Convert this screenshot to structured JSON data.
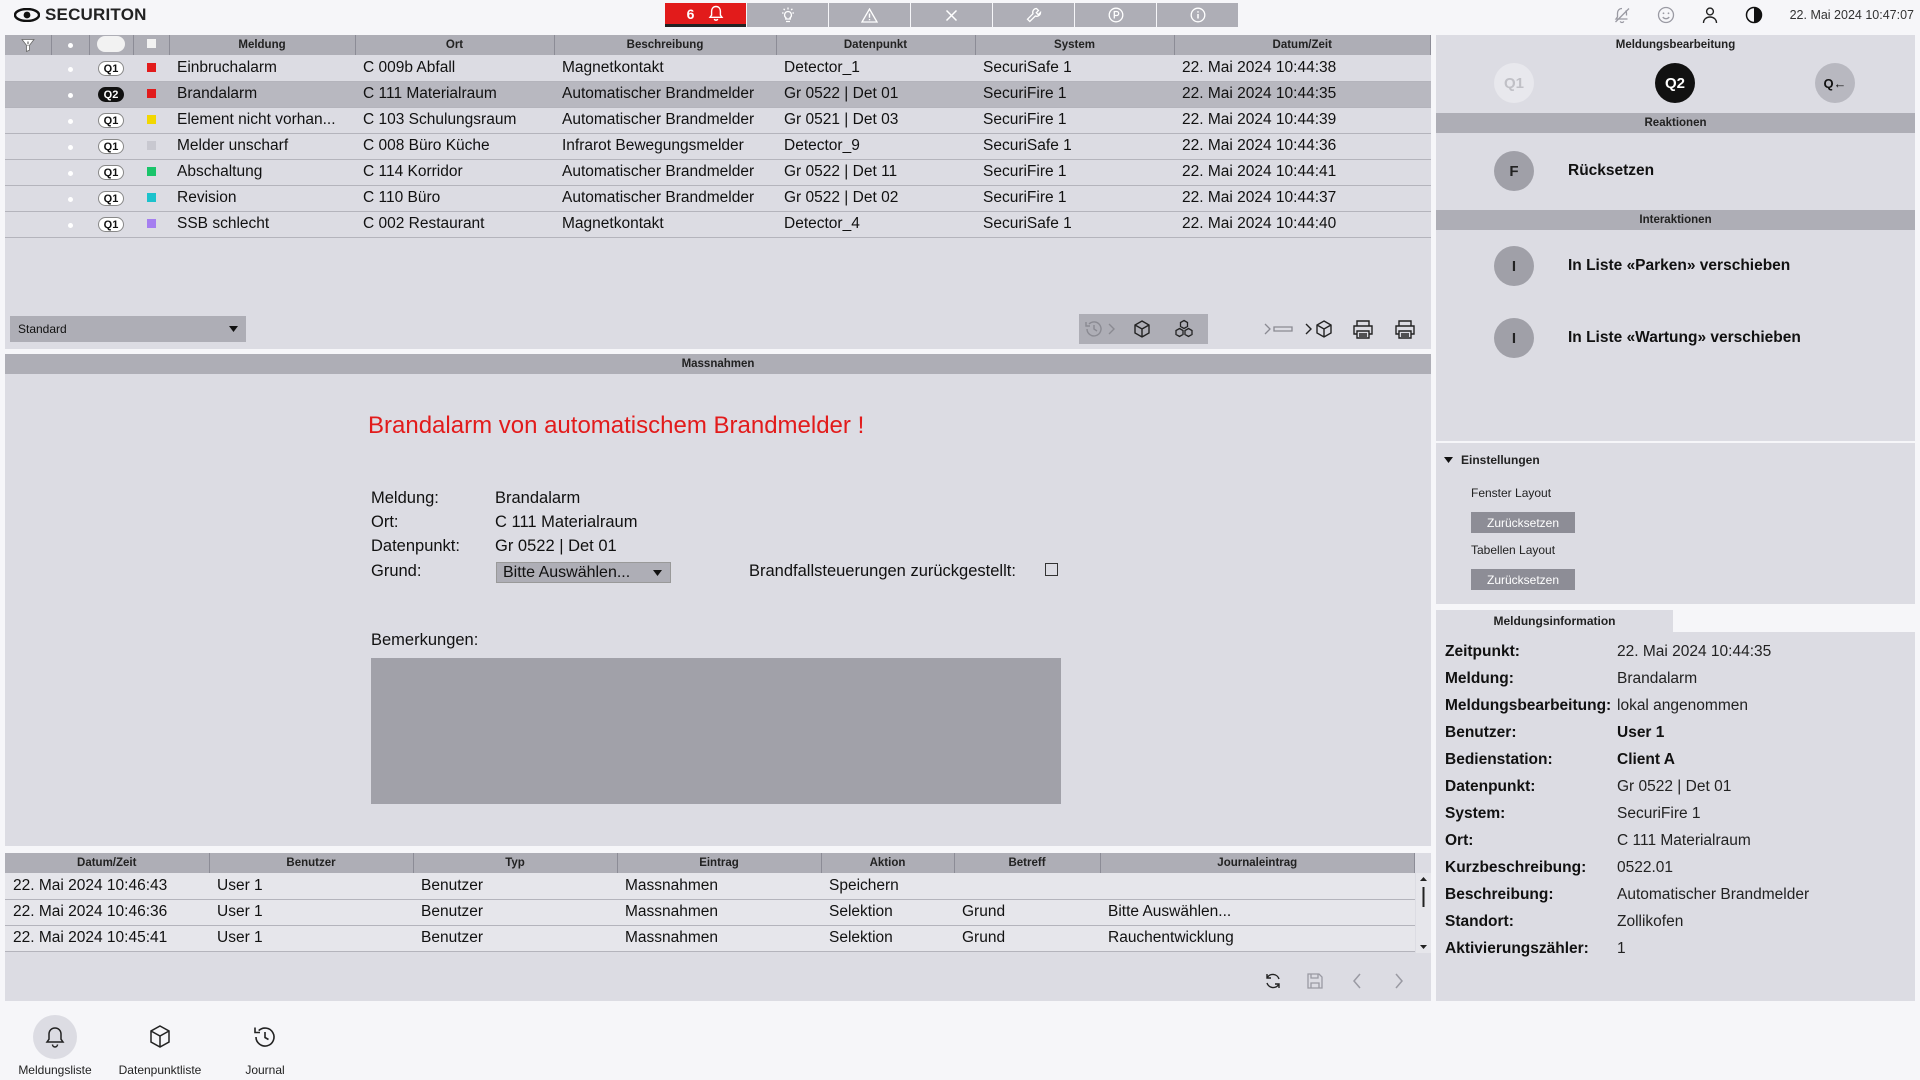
{
  "app": {
    "brand": "SECURITON",
    "datetime": "22. Mai 2024 10:47:07"
  },
  "toptabs": {
    "alarm_count": "6",
    "tabs": [
      "bell-icon",
      "lamp-icon",
      "warning-icon",
      "close-icon",
      "wrench-icon",
      "parking-icon",
      "info-icon"
    ]
  },
  "colors": {
    "alarm_red": "#e21b1b",
    "panel": "#dcdce3",
    "header": "#aeaeb6"
  },
  "msglist": {
    "columns": [
      "Meldung",
      "Ort",
      "Beschreibung",
      "Datenpunkt",
      "System",
      "Datum/Zeit"
    ],
    "rows": [
      {
        "q": "Q1",
        "color": "#e21b1b",
        "meldung": "Einbruchalarm",
        "ort": "C 009b Abfall",
        "beschreibung": "Magnetkontakt",
        "datenpunkt": "Detector_1",
        "system": "SecuriSafe 1",
        "datum": "22. Mai 2024 10:44:38"
      },
      {
        "q": "Q2",
        "color": "#e21b1b",
        "meldung": "Brandalarm",
        "ort": "C 111 Materialraum",
        "beschreibung": "Automatischer Brandmelder",
        "datenpunkt": "Gr 0522 | Det 01",
        "system": "SecuriFire 1",
        "datum": "22. Mai 2024 10:44:35"
      },
      {
        "q": "Q1",
        "color": "#f2d700",
        "meldung": "Element nicht vorhan...",
        "ort": "C 103 Schulungsraum",
        "beschreibung": "Automatischer Brandmelder",
        "datenpunkt": "Gr 0521 | Det 03",
        "system": "SecuriFire 1",
        "datum": "22. Mai 2024 10:44:39"
      },
      {
        "q": "Q1",
        "color": "#c8c8d0",
        "meldung": "Melder unscharf",
        "ort": "C 008 Büro Küche",
        "beschreibung": "Infrarot Bewegungsmelder",
        "datenpunkt": "Detector_9",
        "system": "SecuriSafe 1",
        "datum": "22. Mai 2024 10:44:36"
      },
      {
        "q": "Q1",
        "color": "#19c46a",
        "meldung": "Abschaltung",
        "ort": "C 114 Korridor",
        "beschreibung": "Automatischer Brandmelder",
        "datenpunkt": "Gr 0522 | Det 11",
        "system": "SecuriFire 1",
        "datum": "22. Mai 2024 10:44:41"
      },
      {
        "q": "Q1",
        "color": "#1cc2cc",
        "meldung": "Revision",
        "ort": "C 110 Büro",
        "beschreibung": "Automatischer Brandmelder",
        "datenpunkt": "Gr 0522 | Det 02",
        "system": "SecuriFire 1",
        "datum": "22. Mai 2024 10:44:37"
      },
      {
        "q": "Q1",
        "color": "#a57ef0",
        "meldung": "SSB schlecht",
        "ort": "C 002 Restaurant",
        "beschreibung": "Magnetkontakt",
        "datenpunkt": "Detector_4",
        "system": "SecuriSafe 1",
        "datum": "22. Mai 2024 10:44:40"
      }
    ],
    "filter_value": "Standard"
  },
  "massnahmen": {
    "header": "Massnahmen",
    "title": "Brandalarm von automatischem Brandmelder !",
    "meldung_label": "Meldung:",
    "meldung_value": "Brandalarm",
    "ort_label": "Ort:",
    "ort_value": "C 111 Materialraum",
    "datenpunkt_label": "Datenpunkt:",
    "datenpunkt_value": "Gr 0522 | Det 01",
    "grund_label": "Grund:",
    "grund_value": "Bitte Auswählen...",
    "brandfall_label": "Brandfallsteuerungen zurückgestellt:",
    "bemerkungen_label": "Bemerkungen:"
  },
  "journal": {
    "columns": [
      "Datum/Zeit",
      "Benutzer",
      "Typ",
      "Eintrag",
      "Aktion",
      "Betreff",
      "Journaleintrag"
    ],
    "rows": [
      [
        "22. Mai 2024 10:46:43",
        "User 1",
        "Benutzer",
        "Massnahmen",
        "Speichern",
        "",
        ""
      ],
      [
        "22. Mai 2024 10:46:36",
        "User 1",
        "Benutzer",
        "Massnahmen",
        "Selektion",
        "Grund",
        "Bitte Auswählen..."
      ],
      [
        "22. Mai 2024 10:45:41",
        "User 1",
        "Benutzer",
        "Massnahmen",
        "Selektion",
        "Grund",
        "Rauchentwicklung"
      ]
    ]
  },
  "bearbeitung": {
    "header": "Meldungsbearbeitung",
    "q1": "Q1",
    "q2": "Q2",
    "qback": "Q←",
    "reaktionen_header": "Reaktionen",
    "reaktion": {
      "key": "F",
      "label": "Rücksetzen"
    },
    "interaktionen_header": "Interaktionen",
    "interaktionen": [
      {
        "key": "I",
        "label": "In Liste «Parken» verschieben"
      },
      {
        "key": "I",
        "label": "In Liste «Wartung» verschieben"
      }
    ]
  },
  "einstellungen": {
    "header": "Einstellungen",
    "fenster_label": "Fenster Layout",
    "fenster_btn": "Zurücksetzen",
    "tabellen_label": "Tabellen Layout",
    "tabellen_btn": "Zurücksetzen"
  },
  "info": {
    "tab": "Meldungsinformation",
    "rows": [
      {
        "k": "Zeitpunkt:",
        "v": "22. Mai 2024 10:44:35"
      },
      {
        "k": "Meldung:",
        "v": "Brandalarm"
      },
      {
        "k": "Meldungsbearbeitung:",
        "v": "lokal angenommen"
      },
      {
        "k": "Benutzer:",
        "v": "User 1"
      },
      {
        "k": "Bedienstation:",
        "v": "Client A"
      },
      {
        "k": "Datenpunkt:",
        "v": "Gr 0522 | Det 01"
      },
      {
        "k": "System:",
        "v": "SecuriFire 1"
      },
      {
        "k": "Ort:",
        "v": "C 111 Materialraum"
      },
      {
        "k": "Kurzbeschreibung:",
        "v": "0522.01"
      },
      {
        "k": "Beschreibung:",
        "v": "Automatischer Brandmelder"
      },
      {
        "k": "Standort:",
        "v": "Zollikofen"
      },
      {
        "k": "Aktivierungszähler:",
        "v": "1"
      }
    ]
  },
  "nav": {
    "items": [
      "Meldungsliste",
      "Datenpunktliste",
      "Journal"
    ]
  }
}
